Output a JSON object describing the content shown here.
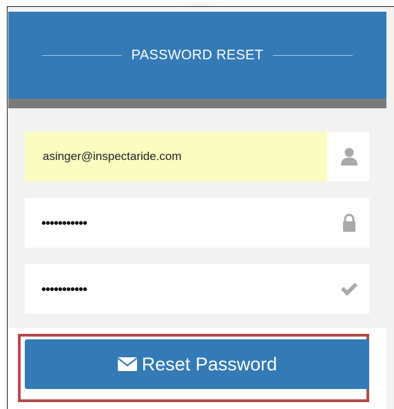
{
  "form": {
    "title": "PASSWORD RESET",
    "email": {
      "value": "asinger@inspectaride.com",
      "icon": "user-icon"
    },
    "new_password": {
      "value": "•••••••••••",
      "icon": "lock-icon"
    },
    "confirm_password": {
      "value": "•••••••••••",
      "icon": "checkmark-icon"
    },
    "submit": {
      "label": "Reset Password",
      "icon": "envelope-icon"
    }
  },
  "colors": {
    "header_blue": "#337ab7",
    "header_strip": "#7a7a7a",
    "autofill_yellow": "#fafcc0",
    "highlight_red": "#b54a4a",
    "icon_gray": "#a9a9a9"
  }
}
